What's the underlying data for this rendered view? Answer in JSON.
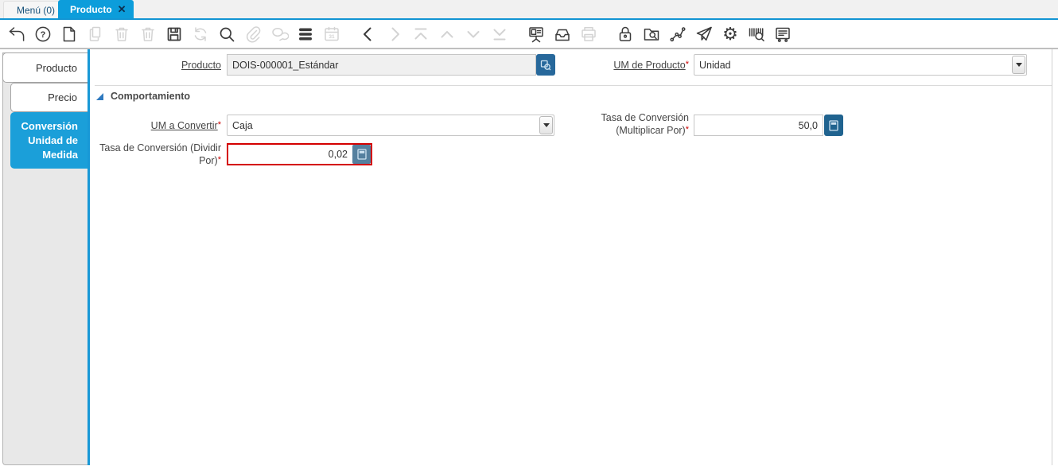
{
  "window_tabs": {
    "menu": {
      "label": "Menú (0)"
    },
    "product": {
      "label": "Producto",
      "close_glyph": "✕"
    }
  },
  "toolbar": {
    "icons": [
      {
        "name": "undo",
        "enabled": true
      },
      {
        "name": "help",
        "enabled": true
      },
      {
        "name": "new-record",
        "enabled": true
      },
      {
        "name": "copy-record",
        "enabled": false
      },
      {
        "name": "delete-record",
        "enabled": false
      },
      {
        "name": "delete-selection",
        "enabled": false
      },
      {
        "name": "save",
        "enabled": true
      },
      {
        "name": "refresh",
        "enabled": false
      },
      {
        "name": "find",
        "enabled": true
      },
      {
        "name": "attachment",
        "enabled": false
      },
      {
        "name": "chat",
        "enabled": false
      },
      {
        "name": "grid-toggle",
        "enabled": true
      },
      {
        "name": "calendar",
        "enabled": false
      },
      {
        "name": "previous-record",
        "enabled": true
      },
      {
        "name": "next-record",
        "enabled": false
      },
      {
        "name": "first-record",
        "enabled": false
      },
      {
        "name": "parent-record",
        "enabled": false
      },
      {
        "name": "detail-record",
        "enabled": false
      },
      {
        "name": "last-record",
        "enabled": false
      },
      {
        "name": "report",
        "enabled": true
      },
      {
        "name": "archive",
        "enabled": true
      },
      {
        "name": "print",
        "enabled": false
      },
      {
        "name": "lock",
        "enabled": true
      },
      {
        "name": "document-search",
        "enabled": true
      },
      {
        "name": "workflow",
        "enabled": true
      },
      {
        "name": "send",
        "enabled": true
      },
      {
        "name": "process",
        "enabled": true,
        "glyph": "⚙"
      },
      {
        "name": "product-info",
        "enabled": true
      },
      {
        "name": "pos",
        "enabled": true
      }
    ]
  },
  "sidebar": {
    "tabs": [
      {
        "label": "Producto",
        "active": false
      },
      {
        "label": "Precio",
        "active": false
      },
      {
        "label": "Conversión Unidad de Medida",
        "active": true
      }
    ]
  },
  "form": {
    "section_title": "Comportamiento",
    "product": {
      "label": "Producto",
      "required": "",
      "value": "DOIS-000001_Estándar"
    },
    "product_uom": {
      "label": "UM de Producto",
      "required": "*",
      "value": "Unidad"
    },
    "uom_to": {
      "label": "UM a Convertir",
      "required": "*",
      "value": "Caja"
    },
    "multiply_rate": {
      "label": "Tasa de Conversión (Multiplicar Por)",
      "required": "*",
      "value": "50,0"
    },
    "divide_rate": {
      "label": "Tasa de Conversión (Dividir Por)",
      "required": "*",
      "value": "0,02"
    }
  },
  "colors": {
    "accent_blue": "#1295d4",
    "active_window_tab": "#0c9ddb",
    "active_sidebar_tab": "#1b9fd9",
    "dark_button_blue": "#27689b",
    "calc_button_blue": "#20638f",
    "required_red": "#cc0000",
    "error_border_red": "#d40000"
  }
}
